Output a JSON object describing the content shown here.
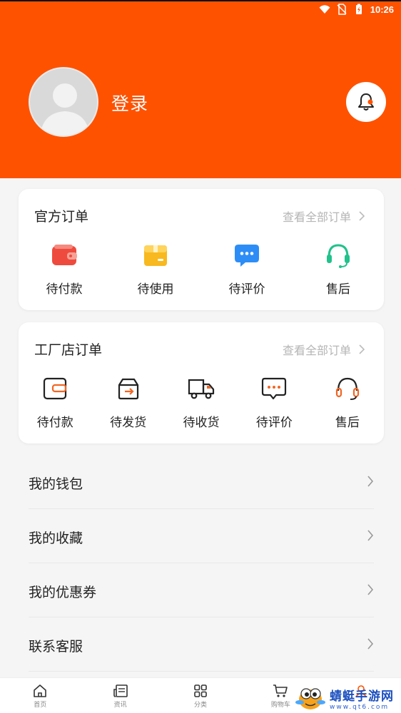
{
  "status_bar": {
    "time": "10:26",
    "icons": [
      "wifi-icon",
      "no-sim-icon",
      "battery-charging-icon"
    ]
  },
  "profile": {
    "login_label": "登录",
    "avatar": "default-avatar-icon",
    "bell": "bell-icon"
  },
  "official_orders": {
    "title": "官方订单",
    "view_all": "查看全部订单",
    "items": [
      {
        "label": "待付款",
        "icon": "wallet-icon",
        "color": "#ee4b3e"
      },
      {
        "label": "待使用",
        "icon": "box-icon",
        "color": "#f8b81f"
      },
      {
        "label": "待评价",
        "icon": "chat-icon",
        "color": "#2d8df7"
      },
      {
        "label": "售后",
        "icon": "headset-icon",
        "color": "#21c28c"
      }
    ]
  },
  "factory_orders": {
    "title": "工厂店订单",
    "view_all": "查看全部订单",
    "items": [
      {
        "label": "待付款",
        "icon": "wallet-outline-icon"
      },
      {
        "label": "待发货",
        "icon": "ship-box-icon"
      },
      {
        "label": "待收货",
        "icon": "truck-icon"
      },
      {
        "label": "待评价",
        "icon": "chat-outline-icon"
      },
      {
        "label": "售后",
        "icon": "headset-outline-icon"
      }
    ],
    "accent": "#f26522"
  },
  "menu": [
    {
      "label": "我的钱包"
    },
    {
      "label": "我的收藏"
    },
    {
      "label": "我的优惠券"
    },
    {
      "label": "联系客服"
    }
  ],
  "tabs": [
    {
      "label": "首页",
      "icon": "home-icon"
    },
    {
      "label": "资讯",
      "icon": "news-icon"
    },
    {
      "label": "分类",
      "icon": "grid-icon"
    },
    {
      "label": "购物车",
      "icon": "cart-icon"
    },
    {
      "label": "",
      "icon": "profile-icon"
    }
  ],
  "watermark": {
    "title": "蜻蜓手游网",
    "subtitle": "www.qt6.com"
  },
  "colors": {
    "brand": "#ff5200",
    "background": "#f5f5f5"
  }
}
